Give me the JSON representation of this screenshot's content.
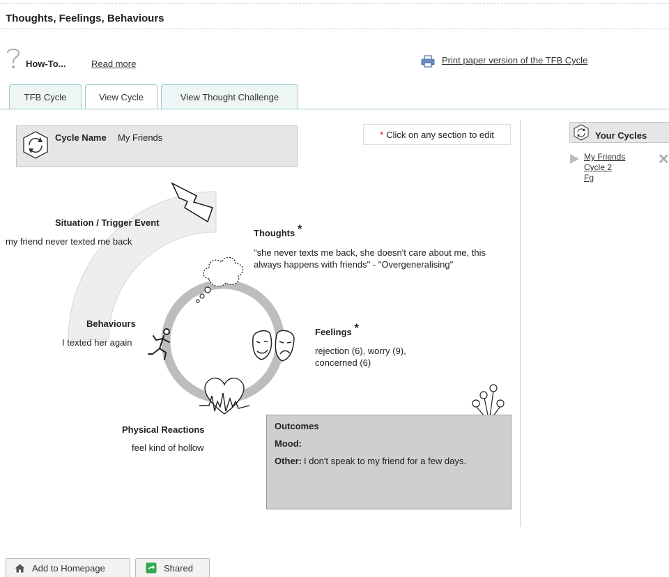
{
  "page": {
    "title": "Thoughts, Feelings, Behaviours"
  },
  "howto": {
    "label": "How-To...",
    "read_more": "Read more"
  },
  "print": {
    "label": "Print paper version of the TFB Cycle"
  },
  "tabs": [
    {
      "label": "TFB Cycle",
      "active": false
    },
    {
      "label": "View Cycle",
      "active": true
    },
    {
      "label": "View Thought Challenge",
      "active": false
    }
  ],
  "cycle": {
    "name_label": "Cycle Name",
    "name_value": "My Friends",
    "click_note_star": "*",
    "click_note": "Click on any section to edit",
    "situation": {
      "title": "Situation / Trigger Event",
      "text": "my friend never texted me back"
    },
    "thoughts": {
      "title": "Thoughts",
      "star": "*",
      "line1": "\"she never texts me back, she doesn't care about me, this",
      "line2": "always happens with friends\" - \"Overgeneralising\""
    },
    "behaviours": {
      "title": "Behaviours",
      "text": "I texted her again"
    },
    "feelings": {
      "title": "Feelings",
      "star": "*",
      "line1": "rejection (6), worry (9),",
      "line2": "concerned (6)"
    },
    "physical": {
      "title": "Physical Reactions",
      "text": "feel kind of hollow"
    },
    "outcomes": {
      "title": "Outcomes",
      "mood_label": "Mood:",
      "other_label": "Other:",
      "other_value": "I don't speak to my friend for a few days."
    }
  },
  "your_cycles": {
    "title": "Your Cycles",
    "items": [
      "My Friends",
      "Cycle 2",
      "Fg"
    ],
    "remove_glyph": "✕"
  },
  "footer": {
    "add_home": "Add to Homepage",
    "shared": "Shared"
  },
  "colors": {
    "tab_border": "#99cccc",
    "shared_green": "#2fa84f",
    "link_blue": "#3a62a8"
  }
}
